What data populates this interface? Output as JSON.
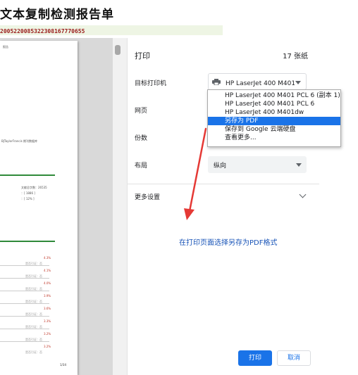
{
  "doc": {
    "title": "文本复制检测报告单",
    "id_line": "2005220085322308167770655"
  },
  "preview": {
    "page_number": "1/34",
    "lines": [
      "报告"
    ],
    "mid_text": "BJTaylorFrancis 期刊数据库",
    "stats": [
      "文献总字数：26535",
      "：[ 1886 ]",
      "：[ 12% ]"
    ],
    "numbers": [
      "4.3%",
      "4.1%",
      "4.0%",
      "3.9%",
      "3.6%",
      "3.3%",
      "3.2%",
      "3.2%"
    ],
    "sub": "是否引证：否"
  },
  "panel": {
    "title": "打印",
    "page_count": "17 张纸",
    "destination_label": "目标打印机",
    "destination_value": "HP LaserJet 400 M401 PCL 6 (副本 1)",
    "pages_label": "网页",
    "copies_label": "份数",
    "layout_label": "布局",
    "layout_value": "纵向",
    "more_settings": "更多设置",
    "print_button": "打印",
    "cancel_button": "取消"
  },
  "dropdown": {
    "options": [
      "HP LaserJet 400 M401 PCL 6 (副本 1)",
      "HP LaserJet 400 M401 PCL 6",
      "HP LaserJet 400 M401dw",
      "另存为 PDF",
      "保存到 Google 云端硬盘",
      "查看更多..."
    ],
    "selected_index": 3
  },
  "annotation": "在打印页面选择另存为PDF格式",
  "colors": {
    "accent": "#1a73e8",
    "annotation": "#1a55b8",
    "arrow": "#e53935"
  }
}
